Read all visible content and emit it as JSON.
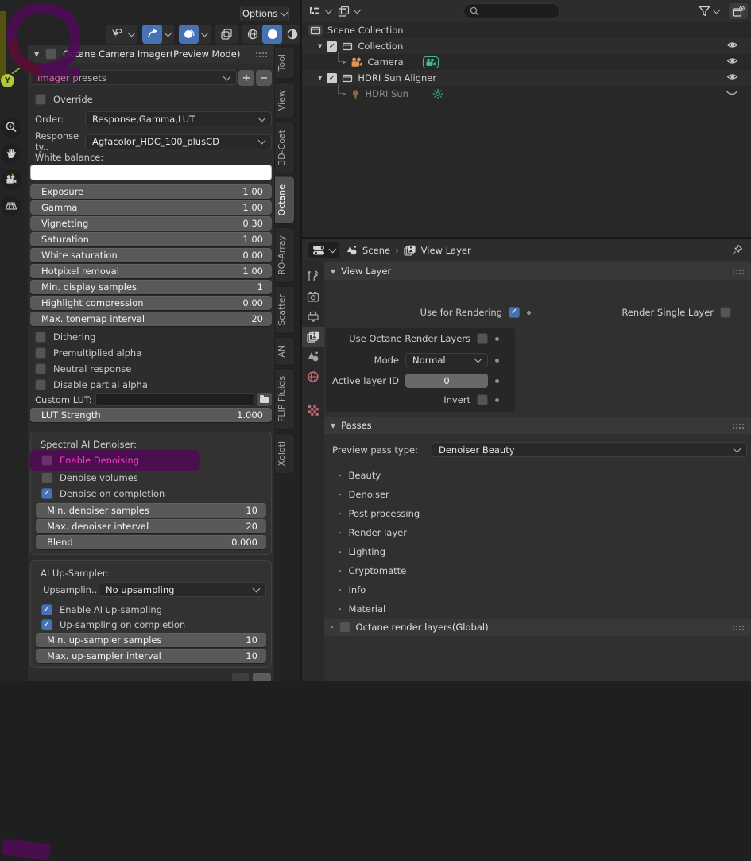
{
  "colors": {
    "accent_blue": "#4772b3",
    "annotation_purple": "#4d0c52",
    "annotation_text_pink": "#f03ec9",
    "object_orange": "#e09553",
    "data_green": "#3dbd8f",
    "warn_red": "#c96a72"
  },
  "icons": {
    "collapse": "▼",
    "expand": "▸",
    "check": "✓",
    "plus": "+",
    "minus": "−",
    "y_axis": "Y",
    "breadcrumb_sep": "›"
  },
  "viewport": {
    "options_button": "Options",
    "toolbar": [
      "show-gizmo",
      "gizmo-toggle",
      "overlays-toggle",
      "xray-toggle",
      "shading-wireframe",
      "shading-solid",
      "shading-material"
    ]
  },
  "sidebar": {
    "panel_title": "Octane Camera Imager(Preview Mode)",
    "presets": {
      "value": "Imager presets",
      "highlight_part": "Imager p",
      "normal_part": "resets"
    },
    "override_label": "Override",
    "order": {
      "label": "Order:",
      "value": "Response,Gamma,LUT"
    },
    "response": {
      "label": "Response ty..",
      "value": "Agfacolor_HDC_100_plusCD"
    },
    "white_balance_label": "White balance:",
    "sliders": [
      {
        "label": "Exposure",
        "value": "1.00"
      },
      {
        "label": "Gamma",
        "value": "1.00"
      },
      {
        "label": "Vignetting",
        "value": "0.30"
      },
      {
        "label": "Saturation",
        "value": "1.00"
      },
      {
        "label": "White saturation",
        "value": "0.00"
      },
      {
        "label": "Hotpixel removal",
        "value": "1.00"
      },
      {
        "label": "Min. display samples",
        "value": "1"
      },
      {
        "label": "Highlight compression",
        "value": "0.00"
      },
      {
        "label": "Max. tonemap interval",
        "value": "20"
      }
    ],
    "checkboxes": [
      {
        "label": "Dithering"
      },
      {
        "label": "Premultiplied alpha"
      },
      {
        "label": "Neutral response"
      },
      {
        "label": "Disable partial alpha"
      }
    ],
    "custom_lut_label": "Custom LUT:",
    "lut_strength": {
      "label": "LUT Strength",
      "value": "1.000"
    },
    "denoiser": {
      "title": "Spectral AI Denoiser:",
      "enable_label": "Enable Denoising",
      "volumes_label": "Denoise volumes",
      "completion_label": "Denoise on completion",
      "sliders": [
        {
          "label": "Min. denoiser samples",
          "value": "10"
        },
        {
          "label": "Max. denoiser interval",
          "value": "20"
        },
        {
          "label": "Blend",
          "value": "0.000"
        }
      ]
    },
    "upsampler": {
      "title": "AI Up-Sampler:",
      "mode_label": "Upsamplin..",
      "mode_value": "No upsampling",
      "enable_label": "Enable AI up-sampling",
      "completion_label": "Up-sampling on completion",
      "sliders": [
        {
          "label": "Min. up-sampler samples",
          "value": "10"
        },
        {
          "label": "Max. up-sampler interval",
          "value": "10"
        }
      ]
    },
    "tabs": [
      {
        "label": "Tool"
      },
      {
        "label": "View"
      },
      {
        "label": "3D-Coat"
      },
      {
        "label": "Octane"
      },
      {
        "label": "RO-Array"
      },
      {
        "label": "Scatter"
      },
      {
        "label": "AN"
      },
      {
        "label": "FLIP Fluids"
      },
      {
        "label": "Xolotl"
      }
    ]
  },
  "outliner": {
    "search_placeholder": "",
    "rows": [
      {
        "label": "Scene Collection"
      },
      {
        "label": "Collection"
      },
      {
        "label": "Camera"
      },
      {
        "label": "HDRI Sun Aligner"
      },
      {
        "label": "HDRI Sun"
      }
    ]
  },
  "properties": {
    "breadcrumb": {
      "scene": "Scene",
      "view_layer": "View Layer"
    },
    "view_layer_panel": {
      "title": "View Layer",
      "use_for_rendering": "Use for Rendering",
      "render_single_layer": "Render Single Layer",
      "use_octane_render_layers": "Use Octane Render Layers",
      "mode_label": "Mode",
      "mode_value": "Normal",
      "active_layer_id_label": "Active layer ID",
      "active_layer_id_value": "0",
      "invert_label": "Invert"
    },
    "passes": {
      "title": "Passes",
      "preview_label": "Preview pass type:",
      "preview_value": "Denoiser Beauty",
      "items": [
        "Beauty",
        "Denoiser",
        "Post processing",
        "Render layer",
        "Lighting",
        "Cryptomatte",
        "Info",
        "Material"
      ]
    },
    "octane_layers_label": "Octane render layers(Global)"
  }
}
